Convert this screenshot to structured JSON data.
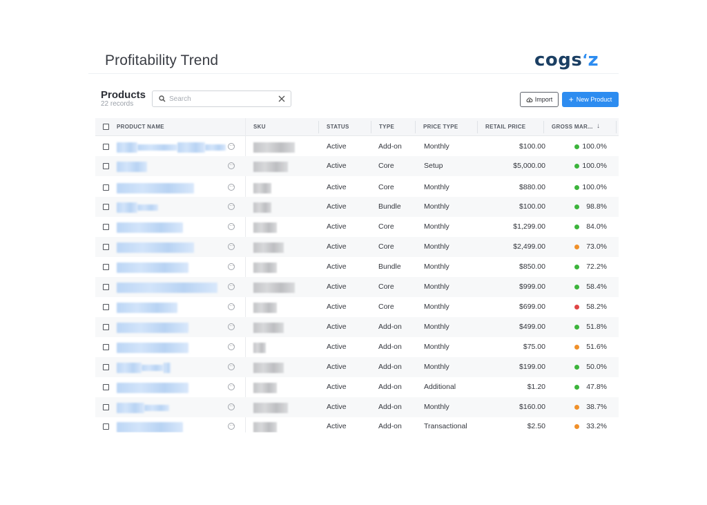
{
  "header": {
    "title": "Profitability Trend",
    "logo": {
      "main": "cogs",
      "accent": "z"
    }
  },
  "products": {
    "title": "Products",
    "subtitle": "22 records"
  },
  "search": {
    "placeholder": "Search",
    "value": ""
  },
  "buttons": {
    "import": "Import",
    "new_product": "New Product"
  },
  "columns": [
    "PRODUCT NAME",
    "SKU",
    "STATUS",
    "TYPE",
    "PRICE TYPE",
    "RETAIL PRICE",
    "GROSS MAR...",
    "↓"
  ],
  "colors": {
    "accent": "#2d8cf0",
    "green": "#3cb43c",
    "orange": "#f0902a",
    "red": "#e04545",
    "logo": "#1b3f63"
  },
  "rows": [
    {
      "status": "Active",
      "type": "Add-on",
      "price_type": "Monthly",
      "retail_price": "$100.00",
      "gross_margin": "100.0%",
      "margin_color": "green"
    },
    {
      "status": "Active",
      "type": "Core",
      "price_type": "Setup",
      "retail_price": "$5,000.00",
      "gross_margin": "100.0%",
      "margin_color": "green"
    },
    {
      "status": "Active",
      "type": "Core",
      "price_type": "Monthly",
      "retail_price": "$880.00",
      "gross_margin": "100.0%",
      "margin_color": "green"
    },
    {
      "status": "Active",
      "type": "Bundle",
      "price_type": "Monthly",
      "retail_price": "$100.00",
      "gross_margin": "98.8%",
      "margin_color": "green"
    },
    {
      "status": "Active",
      "type": "Core",
      "price_type": "Monthly",
      "retail_price": "$1,299.00",
      "gross_margin": "84.0%",
      "margin_color": "green"
    },
    {
      "status": "Active",
      "type": "Core",
      "price_type": "Monthly",
      "retail_price": "$2,499.00",
      "gross_margin": "73.0%",
      "margin_color": "orange"
    },
    {
      "status": "Active",
      "type": "Bundle",
      "price_type": "Monthly",
      "retail_price": "$850.00",
      "gross_margin": "72.2%",
      "margin_color": "green"
    },
    {
      "status": "Active",
      "type": "Core",
      "price_type": "Monthly",
      "retail_price": "$999.00",
      "gross_margin": "58.4%",
      "margin_color": "green"
    },
    {
      "status": "Active",
      "type": "Core",
      "price_type": "Monthly",
      "retail_price": "$699.00",
      "gross_margin": "58.2%",
      "margin_color": "red"
    },
    {
      "status": "Active",
      "type": "Add-on",
      "price_type": "Monthly",
      "retail_price": "$499.00",
      "gross_margin": "51.8%",
      "margin_color": "green"
    },
    {
      "status": "Active",
      "type": "Add-on",
      "price_type": "Monthly",
      "retail_price": "$75.00",
      "gross_margin": "51.6%",
      "margin_color": "orange"
    },
    {
      "status": "Active",
      "type": "Add-on",
      "price_type": "Monthly",
      "retail_price": "$199.00",
      "gross_margin": "50.0%",
      "margin_color": "green"
    },
    {
      "status": "Active",
      "type": "Add-on",
      "price_type": "Additional",
      "retail_price": "$1.20",
      "gross_margin": "47.8%",
      "margin_color": "green"
    },
    {
      "status": "Active",
      "type": "Add-on",
      "price_type": "Monthly",
      "retail_price": "$160.00",
      "gross_margin": "38.7%",
      "margin_color": "orange"
    },
    {
      "status": "Active",
      "type": "Add-on",
      "price_type": "Transactional",
      "retail_price": "$2.50",
      "gross_margin": "33.2%",
      "margin_color": "orange"
    }
  ]
}
